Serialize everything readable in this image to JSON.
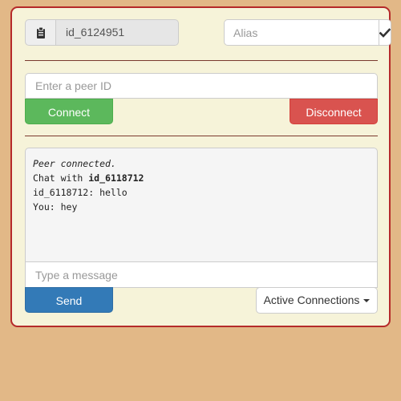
{
  "identity": {
    "id_icon": "clipboard-icon",
    "peer_id": "id_6124951"
  },
  "alias": {
    "placeholder": "Alias",
    "value": "",
    "confirm_icon": "checkmark-icon"
  },
  "connection": {
    "peer_placeholder": "Enter a peer ID",
    "connect_label": "Connect",
    "disconnect_label": "Disconnect"
  },
  "chat": {
    "status_line": "Peer connected.",
    "chat_with_prefix": "Chat with ",
    "chat_with_peer": "id_6118712",
    "messages": [
      "id_6118712: hello",
      "You: hey"
    ]
  },
  "composer": {
    "placeholder": "Type a message",
    "send_label": "Send",
    "active_connections_label": "Active Connections"
  },
  "colors": {
    "page_bg": "#e2b887",
    "panel_bg": "#f6f3d9",
    "panel_border": "#b52a2a",
    "connect": "#5cb85c",
    "disconnect": "#d9534f",
    "send": "#337ab7"
  }
}
